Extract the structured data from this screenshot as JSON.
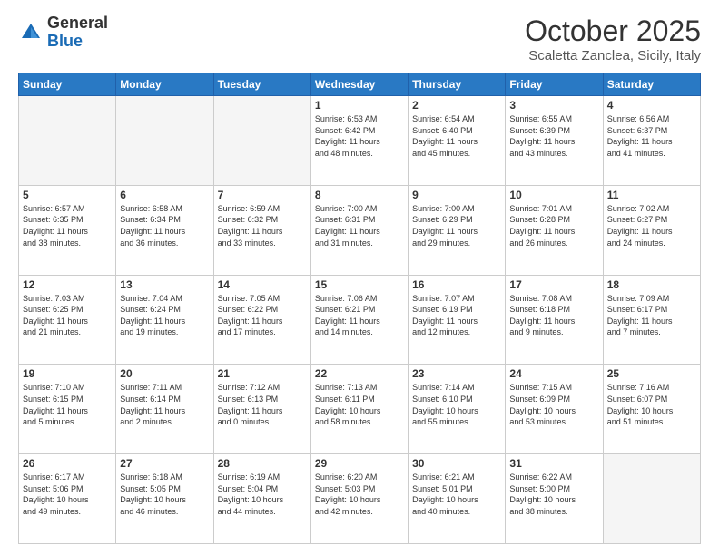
{
  "header": {
    "logo_general": "General",
    "logo_blue": "Blue",
    "month_title": "October 2025",
    "subtitle": "Scaletta Zanclea, Sicily, Italy"
  },
  "days_of_week": [
    "Sunday",
    "Monday",
    "Tuesday",
    "Wednesday",
    "Thursday",
    "Friday",
    "Saturday"
  ],
  "weeks": [
    [
      {
        "day": "",
        "info": ""
      },
      {
        "day": "",
        "info": ""
      },
      {
        "day": "",
        "info": ""
      },
      {
        "day": "1",
        "info": "Sunrise: 6:53 AM\nSunset: 6:42 PM\nDaylight: 11 hours\nand 48 minutes."
      },
      {
        "day": "2",
        "info": "Sunrise: 6:54 AM\nSunset: 6:40 PM\nDaylight: 11 hours\nand 45 minutes."
      },
      {
        "day": "3",
        "info": "Sunrise: 6:55 AM\nSunset: 6:39 PM\nDaylight: 11 hours\nand 43 minutes."
      },
      {
        "day": "4",
        "info": "Sunrise: 6:56 AM\nSunset: 6:37 PM\nDaylight: 11 hours\nand 41 minutes."
      }
    ],
    [
      {
        "day": "5",
        "info": "Sunrise: 6:57 AM\nSunset: 6:35 PM\nDaylight: 11 hours\nand 38 minutes."
      },
      {
        "day": "6",
        "info": "Sunrise: 6:58 AM\nSunset: 6:34 PM\nDaylight: 11 hours\nand 36 minutes."
      },
      {
        "day": "7",
        "info": "Sunrise: 6:59 AM\nSunset: 6:32 PM\nDaylight: 11 hours\nand 33 minutes."
      },
      {
        "day": "8",
        "info": "Sunrise: 7:00 AM\nSunset: 6:31 PM\nDaylight: 11 hours\nand 31 minutes."
      },
      {
        "day": "9",
        "info": "Sunrise: 7:00 AM\nSunset: 6:29 PM\nDaylight: 11 hours\nand 29 minutes."
      },
      {
        "day": "10",
        "info": "Sunrise: 7:01 AM\nSunset: 6:28 PM\nDaylight: 11 hours\nand 26 minutes."
      },
      {
        "day": "11",
        "info": "Sunrise: 7:02 AM\nSunset: 6:27 PM\nDaylight: 11 hours\nand 24 minutes."
      }
    ],
    [
      {
        "day": "12",
        "info": "Sunrise: 7:03 AM\nSunset: 6:25 PM\nDaylight: 11 hours\nand 21 minutes."
      },
      {
        "day": "13",
        "info": "Sunrise: 7:04 AM\nSunset: 6:24 PM\nDaylight: 11 hours\nand 19 minutes."
      },
      {
        "day": "14",
        "info": "Sunrise: 7:05 AM\nSunset: 6:22 PM\nDaylight: 11 hours\nand 17 minutes."
      },
      {
        "day": "15",
        "info": "Sunrise: 7:06 AM\nSunset: 6:21 PM\nDaylight: 11 hours\nand 14 minutes."
      },
      {
        "day": "16",
        "info": "Sunrise: 7:07 AM\nSunset: 6:19 PM\nDaylight: 11 hours\nand 12 minutes."
      },
      {
        "day": "17",
        "info": "Sunrise: 7:08 AM\nSunset: 6:18 PM\nDaylight: 11 hours\nand 9 minutes."
      },
      {
        "day": "18",
        "info": "Sunrise: 7:09 AM\nSunset: 6:17 PM\nDaylight: 11 hours\nand 7 minutes."
      }
    ],
    [
      {
        "day": "19",
        "info": "Sunrise: 7:10 AM\nSunset: 6:15 PM\nDaylight: 11 hours\nand 5 minutes."
      },
      {
        "day": "20",
        "info": "Sunrise: 7:11 AM\nSunset: 6:14 PM\nDaylight: 11 hours\nand 2 minutes."
      },
      {
        "day": "21",
        "info": "Sunrise: 7:12 AM\nSunset: 6:13 PM\nDaylight: 11 hours\nand 0 minutes."
      },
      {
        "day": "22",
        "info": "Sunrise: 7:13 AM\nSunset: 6:11 PM\nDaylight: 10 hours\nand 58 minutes."
      },
      {
        "day": "23",
        "info": "Sunrise: 7:14 AM\nSunset: 6:10 PM\nDaylight: 10 hours\nand 55 minutes."
      },
      {
        "day": "24",
        "info": "Sunrise: 7:15 AM\nSunset: 6:09 PM\nDaylight: 10 hours\nand 53 minutes."
      },
      {
        "day": "25",
        "info": "Sunrise: 7:16 AM\nSunset: 6:07 PM\nDaylight: 10 hours\nand 51 minutes."
      }
    ],
    [
      {
        "day": "26",
        "info": "Sunrise: 6:17 AM\nSunset: 5:06 PM\nDaylight: 10 hours\nand 49 minutes."
      },
      {
        "day": "27",
        "info": "Sunrise: 6:18 AM\nSunset: 5:05 PM\nDaylight: 10 hours\nand 46 minutes."
      },
      {
        "day": "28",
        "info": "Sunrise: 6:19 AM\nSunset: 5:04 PM\nDaylight: 10 hours\nand 44 minutes."
      },
      {
        "day": "29",
        "info": "Sunrise: 6:20 AM\nSunset: 5:03 PM\nDaylight: 10 hours\nand 42 minutes."
      },
      {
        "day": "30",
        "info": "Sunrise: 6:21 AM\nSunset: 5:01 PM\nDaylight: 10 hours\nand 40 minutes."
      },
      {
        "day": "31",
        "info": "Sunrise: 6:22 AM\nSunset: 5:00 PM\nDaylight: 10 hours\nand 38 minutes."
      },
      {
        "day": "",
        "info": ""
      }
    ]
  ]
}
